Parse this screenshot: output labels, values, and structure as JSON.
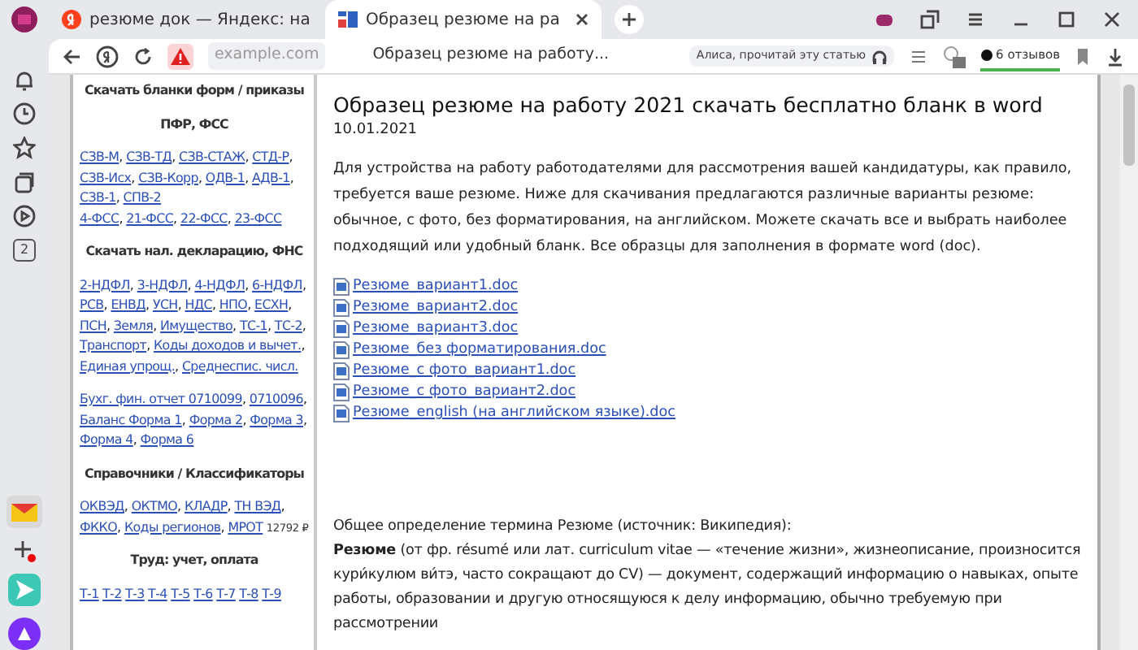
{
  "browser": {
    "tabs": [
      {
        "title": "резюме док — Яндекс: на",
        "kind": "search",
        "selected": false
      },
      {
        "title": "Образец резюме на ра",
        "kind": "site",
        "selected": true
      }
    ],
    "address": "example.com",
    "page_title": "Образец резюме на работу...",
    "alice_prompt": "Алиса, прочитай эту статью",
    "reviews": "6 отзывов",
    "rail_badge": "2"
  },
  "sidebar": [
    {
      "kind": "heading",
      "text": "Скачать бланки форм / приказы"
    },
    {
      "kind": "heading",
      "text": "ПФР, ФСС"
    },
    {
      "kind": "links",
      "separator": ",",
      "lines": [
        {
          "links": [
            "СЗВ-М",
            "СЗВ-ТД",
            "СЗВ-СТАЖ",
            "СТД-Р",
            "СЗВ-Исх",
            "СЗВ-Корр",
            "ОДВ-1",
            "АДВ-1",
            "СЗВ-1",
            "СПВ-2"
          ]
        },
        {
          "links": [
            "4-ФСС",
            "21-ФСС",
            "22-ФСС",
            "23-ФСС"
          ]
        }
      ]
    },
    {
      "kind": "heading",
      "text": "Скачать нал. декларацию, ФНС"
    },
    {
      "kind": "links",
      "separator": ",",
      "lines": [
        {
          "links": [
            "2-НДФЛ",
            "3-НДФЛ",
            "4-НДФЛ",
            "6-НДФЛ",
            "РСВ",
            "ЕНВД",
            "УСН",
            "НДС",
            "НПО",
            "ЕСХН",
            "ПСН",
            "Земля",
            "Имущество",
            "ТС-1",
            "ТС-2",
            "Транспорт",
            "Коды доходов и вычет.",
            "Единая упрощ.",
            "Среднеспис. числ."
          ]
        }
      ]
    },
    {
      "kind": "links",
      "separator": ",",
      "lines": [
        {
          "links": [
            "Бухг. фин. отчет 0710099",
            "0710096",
            "Баланс Форма 1",
            "Форма 2",
            "Форма 3",
            "Форма 4",
            "Форма 6"
          ]
        }
      ]
    },
    {
      "kind": "heading",
      "text": "Справочники / Классификаторы"
    },
    {
      "kind": "links",
      "separator": ",",
      "lines": [
        {
          "links": [
            "ОКВЭД",
            "ОКТМО",
            "КЛАДР",
            "ТН ВЭД",
            "ФККО",
            "Коды регионов",
            "МРОТ"
          ],
          "note": "12792 ₽"
        }
      ]
    },
    {
      "kind": "heading",
      "text": "Труд: учет, оплата"
    },
    {
      "kind": "links",
      "lines": [
        {
          "links": [
            "Т-1",
            "Т-2",
            "Т-3",
            "Т-4",
            "Т-5",
            "Т-6",
            "Т-7",
            "Т-8",
            "Т-9"
          ]
        }
      ]
    }
  ],
  "article": {
    "title": "Образец резюме на работу 2021 скачать бесплатно бланк в word",
    "date": "10.01.2021",
    "intro": "Для устройства на работу работодателями для рассмотрения вашей кандидатуры, как правило, требуется ваше резюме. Ниже для скачивания предлагаются различные варианты резюме: обычное, с фото, без форматирования, на английском. Можете скачать все и выбрать наиболее подходящий или удобный бланк. Все образцы для заполнения в формате word (doc).",
    "files": [
      "Резюме_вариант1.doc",
      "Резюме_вариант2.doc",
      "Резюме_вариант3.doc",
      "Резюме_без форматирования.doc",
      "Резюме_с фото_вариант1.doc",
      "Резюме_с фото_вариант2.doc",
      "Резюме_english (на английском языке).doc"
    ],
    "definition_heading": "Общее определение термина Резюме (источник: Википедия):",
    "definition": "**Резюме** (от фр. résumé или лат. curriculum vitae — «течение жизни», жизнеописание, произносится кури́кулюм ви́тэ, часто сокращают до CV) — документ, содержащий информацию о навыках, опыте работы, образовании и другую относящуюся к делу информацию, обычно требуемую при рассмотрении"
  }
}
